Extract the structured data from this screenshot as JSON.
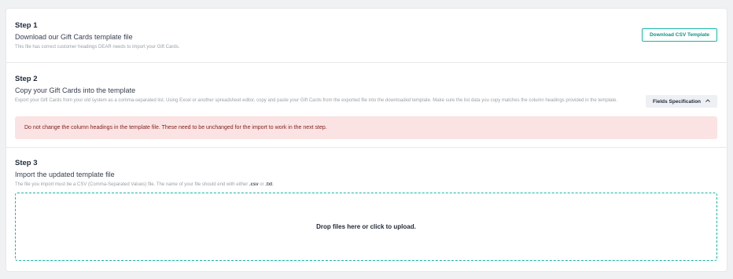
{
  "step1": {
    "title": "Step 1",
    "subtitle": "Download our Gift Cards template file",
    "description": "This file has correct customer headings DEAR needs to import your Gift Cards.",
    "button_label": "Download CSV Template"
  },
  "step2": {
    "title": "Step 2",
    "subtitle": "Copy your Gift Cards into the template",
    "description": "Export your Gift Cards from your old system as a comma-separated list. Using Excel or another spreadsheet editor, copy and paste your Gift Cards from the exported file into the downloaded template. Make sure the list data you copy matches the column headings provided in the template.",
    "button_label": "Fields Specification",
    "button_icon": "chevron-up-icon",
    "alert": "Do not change the column headings in the template file. These need to be unchanged for the import to work in the next step."
  },
  "step3": {
    "title": "Step 3",
    "subtitle": "Import the updated template file",
    "description_prefix": "The file you import must be a CSV (Comma-Separated Values) file. The name of your file should end with either ",
    "ext_csv": ".csv",
    "description_mid": " or ",
    "ext_txt": ".txt",
    "description_suffix": ".",
    "dropzone_label": "Drop files here or click to upload."
  },
  "colors": {
    "accent": "#14b8a6",
    "alert_bg": "#fbe3e3",
    "alert_text": "#7f1d1d",
    "page_bg": "#f0f1f3"
  }
}
